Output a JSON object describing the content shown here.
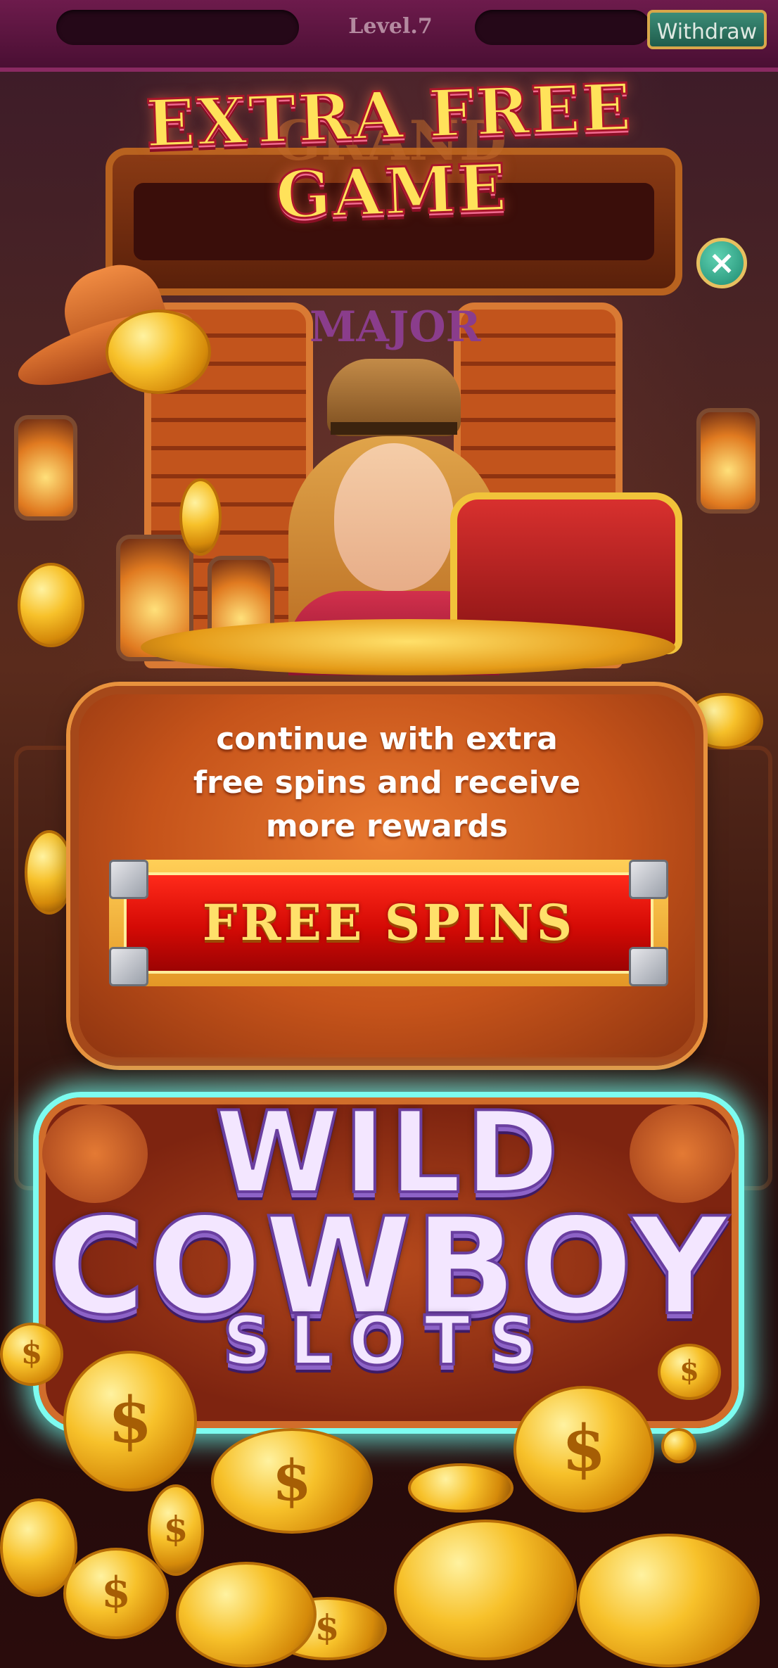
{
  "header": {
    "level": "Level.7",
    "withdraw_label": "Withdraw"
  },
  "popup": {
    "title": "EXTRA FREE GAME",
    "background_jackpots": [
      "GRAND",
      "MAJOR"
    ],
    "message_lines": [
      "continue with extra",
      "free spins and receive",
      "more rewards"
    ],
    "cta_label": "FREE SPINS",
    "close_icon": "close-icon"
  },
  "logo": {
    "line1": "WILD",
    "line2": "COWBOY",
    "line3": "SLOTS"
  },
  "coin_symbol": "$",
  "colors": {
    "topbar": "#5c1440",
    "withdraw_button": "#2a7a64",
    "cta_red": "#e01208",
    "title_yellow": "#ffe25a",
    "logo_glow": "#7dfcf0"
  }
}
